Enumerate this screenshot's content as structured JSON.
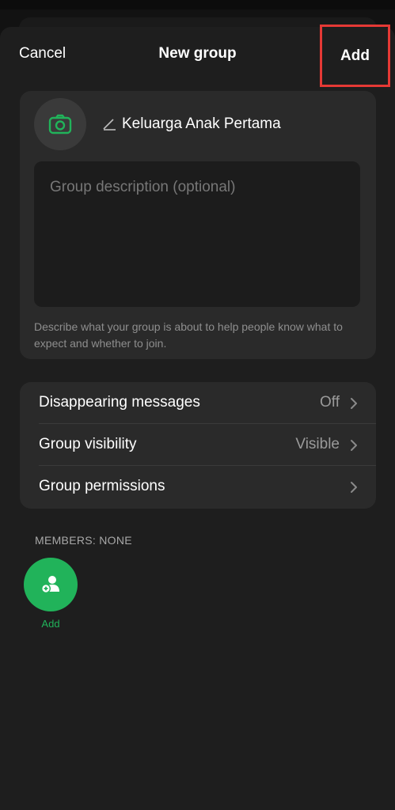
{
  "header": {
    "cancel_label": "Cancel",
    "title": "New group",
    "add_label": "Add"
  },
  "group": {
    "name": "Keluarga Anak Pertama",
    "description_placeholder": "Group description (optional)",
    "description_help": "Describe what your group is about to help people know what to expect and whether to join."
  },
  "settings": {
    "items": [
      {
        "label": "Disappearing messages",
        "value": "Off"
      },
      {
        "label": "Group visibility",
        "value": "Visible"
      },
      {
        "label": "Group permissions",
        "value": ""
      }
    ]
  },
  "members": {
    "label": "MEMBERS: NONE",
    "add_label": "Add"
  },
  "icons": {
    "camera": "camera-icon",
    "pencil": "pencil-icon",
    "chevron": "chevron-right-icon",
    "add_person": "add-person-icon"
  },
  "colors": {
    "accent_green": "#21b35a",
    "highlight_red": "#e53935"
  }
}
